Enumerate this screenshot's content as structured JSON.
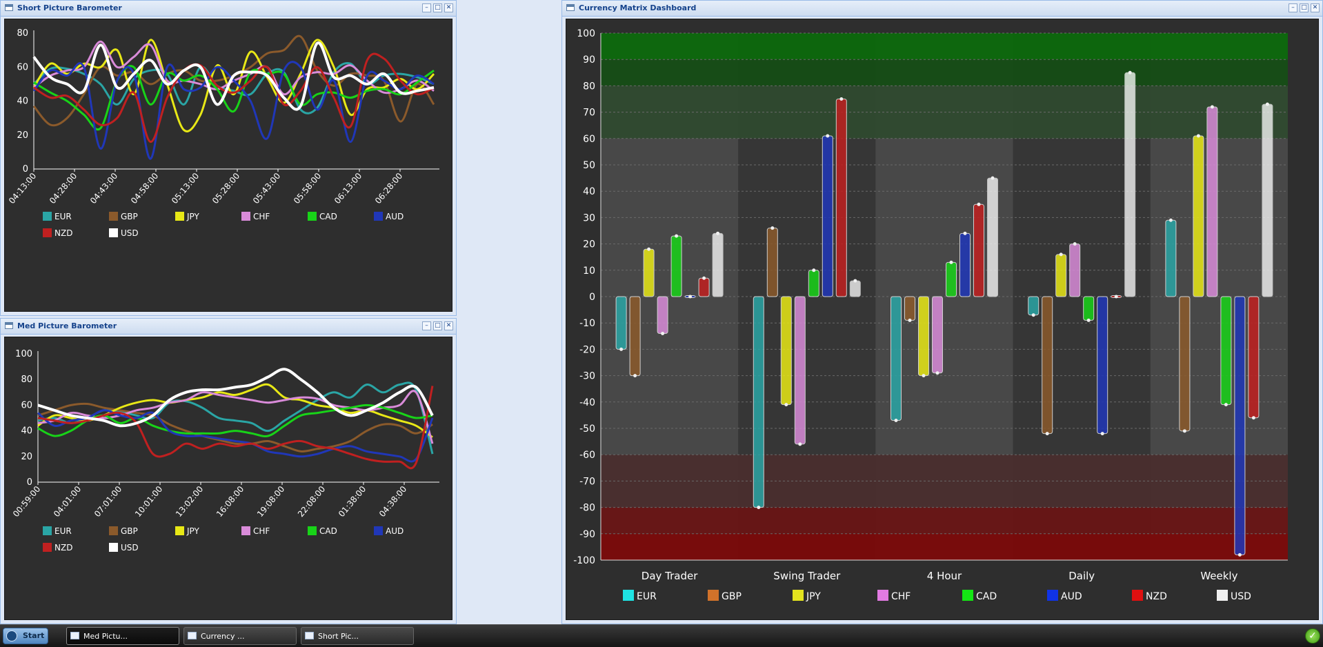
{
  "windows": {
    "short": {
      "title": "Short Picture Barometer"
    },
    "med": {
      "title": "Med Picture Barometer"
    },
    "matrix": {
      "title": "Currency Matrix Dashboard"
    }
  },
  "currencies": [
    {
      "code": "EUR",
      "color": "#2aa5a5"
    },
    {
      "code": "GBP",
      "color": "#8b5a2b"
    },
    {
      "code": "JPY",
      "color": "#e8e816"
    },
    {
      "code": "CHF",
      "color": "#d98bd9"
    },
    {
      "code": "CAD",
      "color": "#18d318"
    },
    {
      "code": "AUD",
      "color": "#2037b8"
    },
    {
      "code": "NZD",
      "color": "#c02020"
    },
    {
      "code": "USD",
      "color": "#ffffff"
    }
  ],
  "matrix_legend_colors": [
    "#1ee3e3",
    "#d1722a",
    "#e3e31e",
    "#e27ae2",
    "#14e614",
    "#1033e6",
    "#e01010",
    "#f0f0f0"
  ],
  "chart_data": [
    {
      "id": "short",
      "type": "line",
      "title": "",
      "xlabel": "",
      "ylabel": "",
      "ylim": [
        0,
        80
      ],
      "yticks": [
        0,
        20,
        40,
        60,
        80
      ],
      "x_tick_labels": [
        "04:13:00",
        "04:28:00",
        "04:43:00",
        "04:58:00",
        "05:13:00",
        "05:28:00",
        "05:43:00",
        "05:58:00",
        "06:13:00",
        "06:28:00"
      ],
      "grid": false,
      "legend": "bottom",
      "series": [
        {
          "name": "EUR",
          "values": [
            50,
            59,
            59,
            56,
            50,
            38,
            53,
            58,
            56,
            38,
            60,
            49,
            46,
            44,
            56,
            57,
            35,
            36,
            57,
            62,
            50,
            55,
            56,
            54,
            50
          ]
        },
        {
          "name": "GBP",
          "values": [
            37,
            26,
            30,
            44,
            60,
            55,
            57,
            50,
            56,
            58,
            52,
            52,
            55,
            60,
            68,
            70,
            78,
            58,
            49,
            56,
            55,
            52,
            28,
            50,
            38
          ]
        },
        {
          "name": "JPY",
          "values": [
            48,
            62,
            56,
            62,
            60,
            70,
            44,
            76,
            50,
            23,
            32,
            61,
            44,
            69,
            54,
            39,
            56,
            76,
            60,
            32,
            47,
            48,
            53,
            47,
            56
          ]
        },
        {
          "name": "CHF",
          "values": [
            48,
            55,
            58,
            60,
            75,
            60,
            66,
            73,
            52,
            52,
            50,
            47,
            52,
            56,
            60,
            44,
            54,
            57,
            56,
            61,
            52,
            45,
            47,
            52,
            46
          ]
        },
        {
          "name": "CAD",
          "values": [
            51,
            45,
            40,
            32,
            24,
            52,
            60,
            38,
            56,
            52,
            55,
            47,
            34,
            57,
            56,
            56,
            38,
            44,
            45,
            42,
            46,
            47,
            44,
            51,
            58
          ]
        },
        {
          "name": "AUD",
          "values": [
            46,
            58,
            55,
            60,
            12,
            52,
            56,
            6,
            60,
            47,
            48,
            60,
            52,
            40,
            18,
            58,
            60,
            35,
            52,
            16,
            55,
            52,
            47,
            55,
            50
          ]
        },
        {
          "name": "NZD",
          "values": [
            48,
            42,
            43,
            35,
            26,
            30,
            45,
            16,
            42,
            58,
            61,
            49,
            45,
            52,
            60,
            38,
            46,
            60,
            42,
            25,
            64,
            65,
            52,
            44,
            48
          ]
        },
        {
          "name": "USD",
          "values": [
            66,
            54,
            50,
            46,
            73,
            48,
            56,
            64,
            50,
            58,
            60,
            38,
            55,
            57,
            55,
            42,
            37,
            74,
            54,
            55,
            50,
            56,
            45,
            46,
            48
          ]
        }
      ]
    },
    {
      "id": "med",
      "type": "line",
      "title": "",
      "xlabel": "",
      "ylabel": "",
      "ylim": [
        0,
        100
      ],
      "yticks": [
        0,
        20,
        40,
        60,
        80,
        100
      ],
      "x_tick_labels": [
        "00:59:00",
        "04:01:00",
        "07:01:00",
        "10:01:00",
        "13:02:00",
        "16:08:00",
        "19:08:00",
        "22:08:00",
        "01:38:00",
        "04:38:00"
      ],
      "grid": false,
      "legend": "bottom",
      "series": [
        {
          "name": "EUR",
          "values": [
            48,
            50,
            46,
            50,
            56,
            55,
            52,
            50,
            62,
            63,
            58,
            50,
            48,
            46,
            40,
            48,
            56,
            64,
            70,
            66,
            76,
            70,
            76,
            72,
            22
          ]
        },
        {
          "name": "GBP",
          "values": [
            52,
            56,
            60,
            61,
            58,
            56,
            54,
            52,
            45,
            40,
            36,
            33,
            30,
            30,
            32,
            28,
            24,
            26,
            28,
            32,
            40,
            45,
            44,
            38,
            45
          ]
        },
        {
          "name": "JPY",
          "values": [
            44,
            52,
            50,
            48,
            52,
            58,
            62,
            64,
            62,
            64,
            66,
            70,
            68,
            72,
            76,
            66,
            64,
            60,
            58,
            54,
            56,
            52,
            48,
            44,
            35
          ]
        },
        {
          "name": "CHF",
          "values": [
            46,
            48,
            54,
            52,
            50,
            52,
            56,
            58,
            62,
            64,
            70,
            68,
            66,
            64,
            62,
            64,
            66,
            65,
            60,
            58,
            56,
            58,
            60,
            70,
            30
          ]
        },
        {
          "name": "CAD",
          "values": [
            42,
            36,
            40,
            48,
            52,
            46,
            50,
            44,
            40,
            38,
            38,
            38,
            40,
            38,
            36,
            44,
            52,
            54,
            56,
            58,
            60,
            58,
            54,
            50,
            52
          ]
        },
        {
          "name": "AUD",
          "values": [
            54,
            44,
            48,
            50,
            56,
            52,
            50,
            54,
            40,
            36,
            36,
            34,
            32,
            30,
            24,
            22,
            20,
            22,
            26,
            28,
            24,
            22,
            20,
            18,
            50
          ]
        },
        {
          "name": "NZD",
          "values": [
            50,
            48,
            46,
            48,
            52,
            54,
            46,
            22,
            22,
            30,
            26,
            30,
            28,
            30,
            26,
            30,
            32,
            28,
            26,
            22,
            18,
            16,
            16,
            15,
            75
          ]
        },
        {
          "name": "USD",
          "values": [
            60,
            56,
            52,
            50,
            48,
            44,
            46,
            52,
            64,
            70,
            72,
            72,
            74,
            76,
            82,
            88,
            80,
            70,
            58,
            52,
            56,
            62,
            70,
            74,
            52
          ]
        }
      ]
    },
    {
      "id": "matrix",
      "type": "bar",
      "title": "",
      "xlabel": "",
      "ylabel": "",
      "ylim": [
        -100,
        100
      ],
      "yticks": [
        -100,
        -90,
        -80,
        -70,
        -60,
        -50,
        -40,
        -30,
        -20,
        -10,
        0,
        10,
        20,
        30,
        40,
        50,
        60,
        70,
        80,
        90,
        100
      ],
      "categories": [
        "Day Trader",
        "Swing Trader",
        "4 Hour",
        "Daily",
        "Weekly"
      ],
      "grid": true,
      "legend": "bottom",
      "zones": [
        {
          "from": 90,
          "to": 100,
          "color": "#0a6a0a"
        },
        {
          "from": 80,
          "to": 90,
          "color": "#134d13"
        },
        {
          "from": 60,
          "to": 80,
          "color": "#2f4a2f"
        },
        {
          "from": -80,
          "to": -60,
          "color": "#4a2e2e"
        },
        {
          "from": -90,
          "to": -80,
          "color": "#6a1414"
        },
        {
          "from": -100,
          "to": -90,
          "color": "#7d0808"
        }
      ],
      "series": [
        {
          "name": "EUR",
          "values": [
            -20,
            -80,
            -47,
            -7,
            29
          ]
        },
        {
          "name": "GBP",
          "values": [
            -30,
            26,
            -9,
            -52,
            -51
          ]
        },
        {
          "name": "JPY",
          "values": [
            18,
            -41,
            -30,
            16,
            61
          ]
        },
        {
          "name": "CHF",
          "values": [
            -14,
            -56,
            -29,
            20,
            72
          ]
        },
        {
          "name": "CAD",
          "values": [
            23,
            10,
            13,
            -9,
            -41
          ]
        },
        {
          "name": "AUD",
          "values": [
            0,
            61,
            24,
            -52,
            -98
          ]
        },
        {
          "name": "NZD",
          "values": [
            7,
            75,
            35,
            0,
            -46
          ]
        },
        {
          "name": "USD",
          "values": [
            24,
            6,
            45,
            85,
            73
          ]
        }
      ]
    }
  ],
  "taskbar": {
    "start_label": "Start",
    "items": [
      "Med Pictu...",
      "Currency ...",
      "Short Pic..."
    ]
  }
}
